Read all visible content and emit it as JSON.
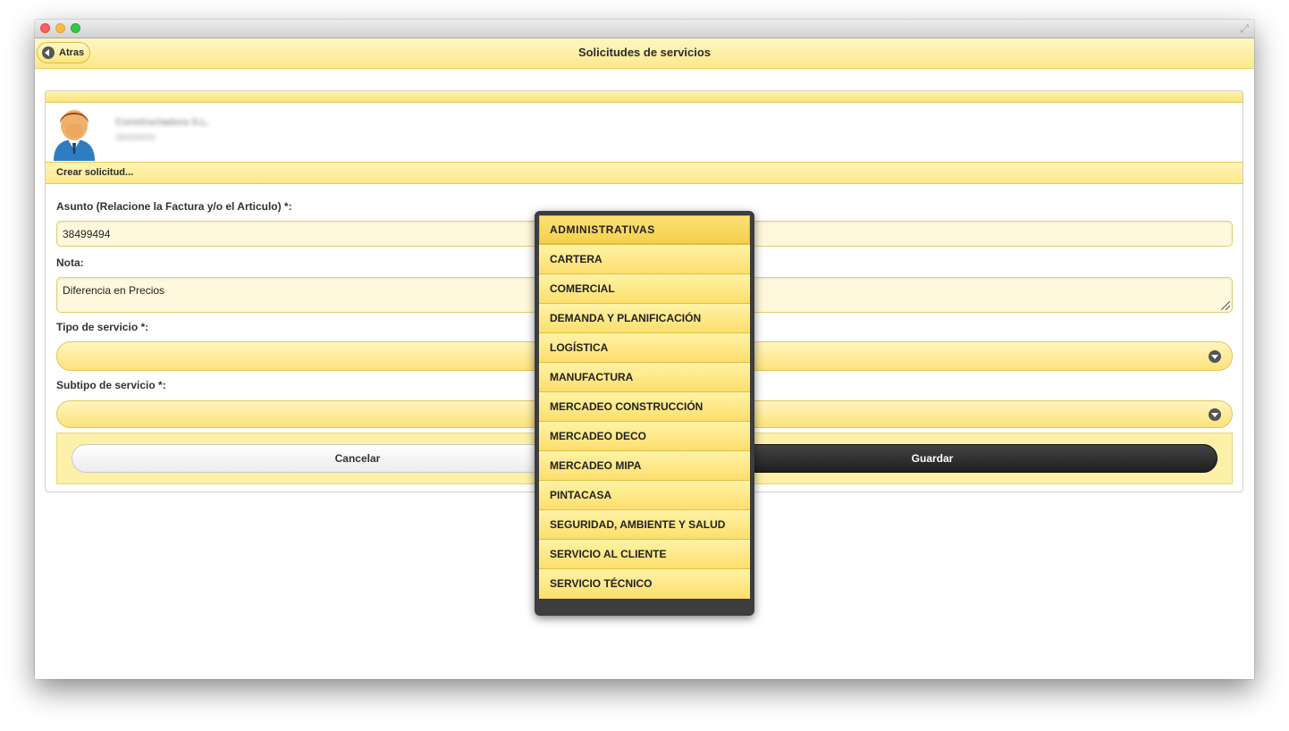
{
  "header": {
    "back_label": "Atras",
    "title": "Solicitudes de servicios"
  },
  "profile": {
    "name": "Constructadora S.L.",
    "id": "38499494"
  },
  "section_label": "Crear solicitud...",
  "form": {
    "asunto_label": "Asunto (Relacione la Factura y/o el Articulo) *:",
    "asunto_value": "38499494",
    "nota_label": "Nota:",
    "nota_value": "Diferencia en Precios",
    "tipo_label": "Tipo de servicio *:",
    "subtipo_label": "Subtipo de servicio *:"
  },
  "buttons": {
    "cancel_label": "Cancelar",
    "save_label": "Guardar"
  },
  "dropdown": {
    "selected_index": 0,
    "options": [
      "ADMINISTRATIVAS",
      "CARTERA",
      "COMERCIAL",
      "DEMANDA Y PLANIFICACIÓN",
      "LOGÍSTICA",
      "MANUFACTURA",
      "MERCADEO CONSTRUCCIÓN",
      "MERCADEO DECO",
      "MERCADEO MIPA",
      "PINTACASA",
      "SEGURIDAD, AMBIENTE Y SALUD",
      "SERVICIO AL CLIENTE",
      "SERVICIO TÉCNICO"
    ]
  },
  "icons": {
    "back": "arrow-left-icon",
    "select": "chevron-down-icon",
    "avatar": "user-avatar-icon",
    "resize": "fullscreen-icon"
  },
  "colors": {
    "header_bg": "#fbe98a",
    "dropdown_frame": "#3d3d3d",
    "save_button": "#2a2a2a"
  }
}
